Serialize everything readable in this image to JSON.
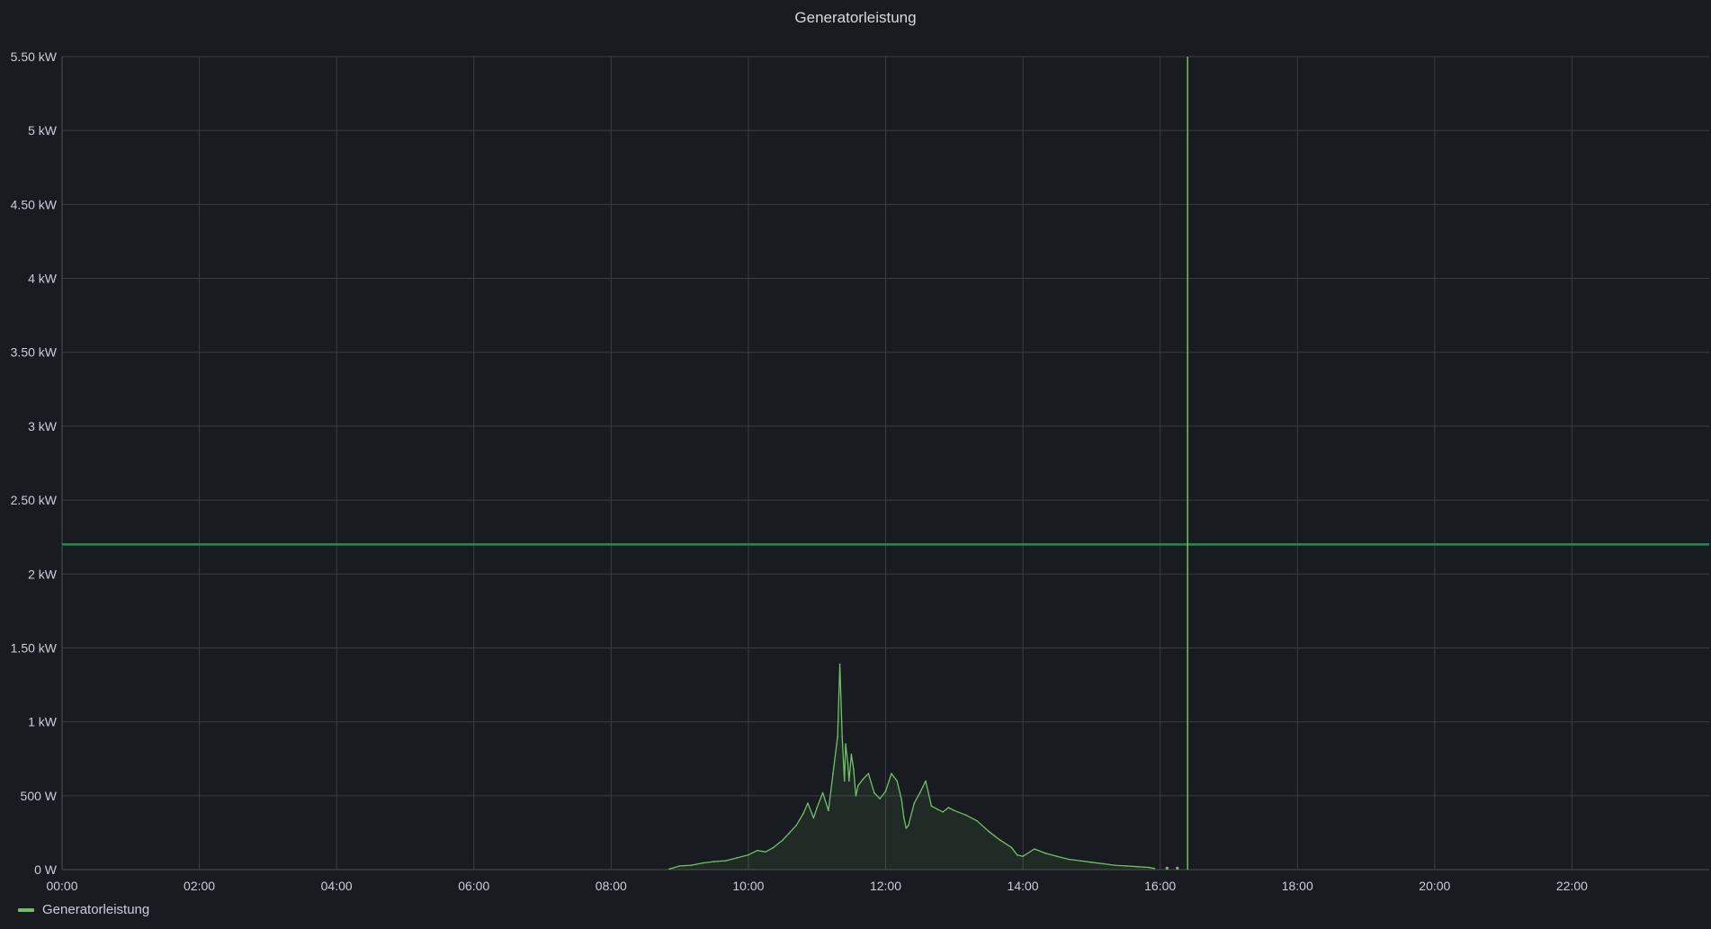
{
  "panel": {
    "title": "Generatorleistung"
  },
  "colors": {
    "series": "#73bf69",
    "threshold": "#1f8f4a",
    "background": "#181b1f",
    "grid": "#3a3d42"
  },
  "chart_data": {
    "type": "area",
    "title": "Generatorleistung",
    "ylabel": "",
    "xlabel": "",
    "y_unit": "W",
    "ylim": [
      0,
      5500
    ],
    "xlim_hours": [
      0,
      24
    ],
    "x_ticks": [
      "00:00",
      "02:00",
      "04:00",
      "06:00",
      "08:00",
      "10:00",
      "12:00",
      "14:00",
      "16:00",
      "18:00",
      "20:00",
      "22:00"
    ],
    "y_ticks": [
      {
        "value": 0,
        "label": "0 W"
      },
      {
        "value": 500,
        "label": "500 W"
      },
      {
        "value": 1000,
        "label": "1 kW"
      },
      {
        "value": 1500,
        "label": "1.50 kW"
      },
      {
        "value": 2000,
        "label": "2 kW"
      },
      {
        "value": 2500,
        "label": "2.50 kW"
      },
      {
        "value": 3000,
        "label": "3 kW"
      },
      {
        "value": 3500,
        "label": "3.50 kW"
      },
      {
        "value": 4000,
        "label": "4 kW"
      },
      {
        "value": 4500,
        "label": "4.50 kW"
      },
      {
        "value": 5000,
        "label": "5 kW"
      },
      {
        "value": 5500,
        "label": "5.50 kW"
      }
    ],
    "threshold_value": 2200,
    "current_time_marker": "16:24",
    "grid": true,
    "legend_position": "bottom-left",
    "series": [
      {
        "name": "Generatorleistung",
        "x": [
          "08:51",
          "09:00",
          "09:10",
          "09:20",
          "09:30",
          "09:40",
          "09:50",
          "10:00",
          "10:08",
          "10:15",
          "10:22",
          "10:30",
          "10:36",
          "10:42",
          "10:48",
          "10:52",
          "10:57",
          "11:00",
          "11:05",
          "11:10",
          "11:14",
          "11:18",
          "11:20",
          "11:22",
          "11:24",
          "11:25",
          "11:27",
          "11:28",
          "11:30",
          "11:32",
          "11:34",
          "11:36",
          "11:40",
          "11:45",
          "11:50",
          "11:55",
          "12:00",
          "12:05",
          "12:10",
          "12:14",
          "12:16",
          "12:18",
          "12:20",
          "12:25",
          "12:30",
          "12:35",
          "12:40",
          "12:45",
          "12:50",
          "12:55",
          "13:00",
          "13:10",
          "13:20",
          "13:30",
          "13:40",
          "13:50",
          "13:55",
          "14:00",
          "14:10",
          "14:20",
          "14:30",
          "14:40",
          "14:50",
          "15:00",
          "15:10",
          "15:20",
          "15:30",
          "15:40",
          "15:50",
          "15:55"
        ],
        "values": [
          5,
          25,
          30,
          45,
          55,
          60,
          80,
          100,
          130,
          120,
          150,
          200,
          250,
          300,
          380,
          450,
          350,
          420,
          520,
          400,
          650,
          900,
          1390,
          900,
          600,
          850,
          720,
          600,
          780,
          680,
          500,
          570,
          610,
          650,
          520,
          480,
          530,
          650,
          600,
          470,
          350,
          280,
          300,
          450,
          520,
          600,
          430,
          410,
          390,
          420,
          400,
          370,
          330,
          260,
          200,
          150,
          100,
          90,
          140,
          110,
          90,
          70,
          60,
          50,
          40,
          30,
          25,
          20,
          15,
          8
        ]
      }
    ]
  }
}
